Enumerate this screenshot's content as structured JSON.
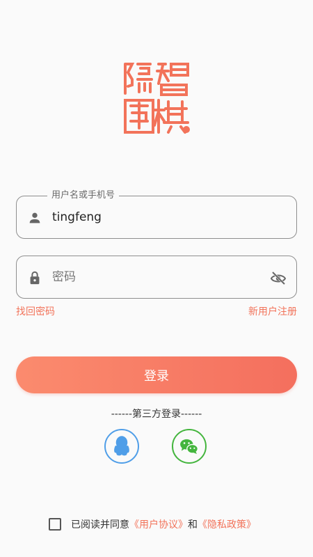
{
  "logo": {
    "text": "隐智围棋"
  },
  "username": {
    "legend": "用户名或手机号",
    "value": "tingfeng"
  },
  "password": {
    "placeholder": "密码"
  },
  "links": {
    "forgot": "找回密码",
    "register": "新用户注册"
  },
  "login_button": "登录",
  "third_party": {
    "title": "------第三方登录------"
  },
  "agreement": {
    "prefix": "已阅读并同意",
    "user_agreement": "《用户协议》",
    "conjunction": "和",
    "privacy_policy": "《隐私政策》"
  },
  "colors": {
    "accent": "#f2735a",
    "qq": "#4f9ee8",
    "wechat": "#44b53e"
  }
}
